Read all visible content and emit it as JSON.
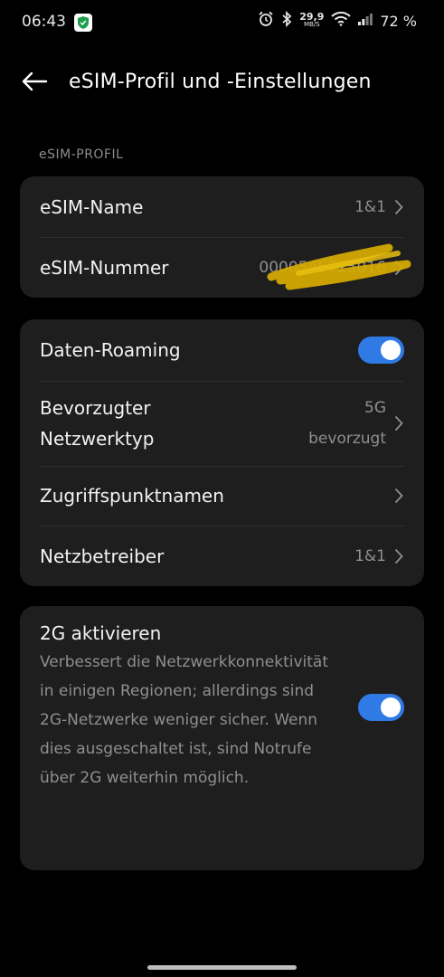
{
  "status_bar": {
    "time": "06:43",
    "speed_value": "29,9",
    "speed_unit": "MB/S",
    "battery": "72 %",
    "icons": [
      "shield-app-icon",
      "alarm-icon",
      "bluetooth-icon",
      "wifi-icon",
      "signal-icon"
    ]
  },
  "header": {
    "title": "eSIM-Profil und -Einstellungen",
    "back_icon": "arrow-left-icon"
  },
  "section": {
    "esim_profile_label": "eSIM-PROFIL"
  },
  "profile_card": {
    "name_label": "eSIM-Name",
    "name_value": "1&1",
    "number_label": "eSIM-Nummer",
    "number_value": "0000545725016"
  },
  "network_card": {
    "roaming_label": "Daten-Roaming",
    "roaming_on": true,
    "preferred_label_line1": "Bevorzugter",
    "preferred_label_line2": "Netzwerktyp",
    "preferred_value_line1": "5G",
    "preferred_value_line2": "bevorzugt",
    "apn_label": "Zugriffspunktnamen",
    "operator_label": "Netzbetreiber",
    "operator_value": "1&1"
  },
  "twog_card": {
    "title": "2G aktivieren",
    "description": "Verbessert die Netzwerkkonnektivität in einigen Regionen; allerdings sind 2G-Netzwerke weniger sicher. Wenn dies ausgeschaltet ist, sind Notrufe über 2G weiterhin möglich.",
    "enabled": true
  },
  "colors": {
    "background": "#000000",
    "card": "#1e1e1e",
    "accent_toggle": "#2f7ae5",
    "secondary_text": "#8f8f8f",
    "redaction_marker": "#e3b500"
  }
}
